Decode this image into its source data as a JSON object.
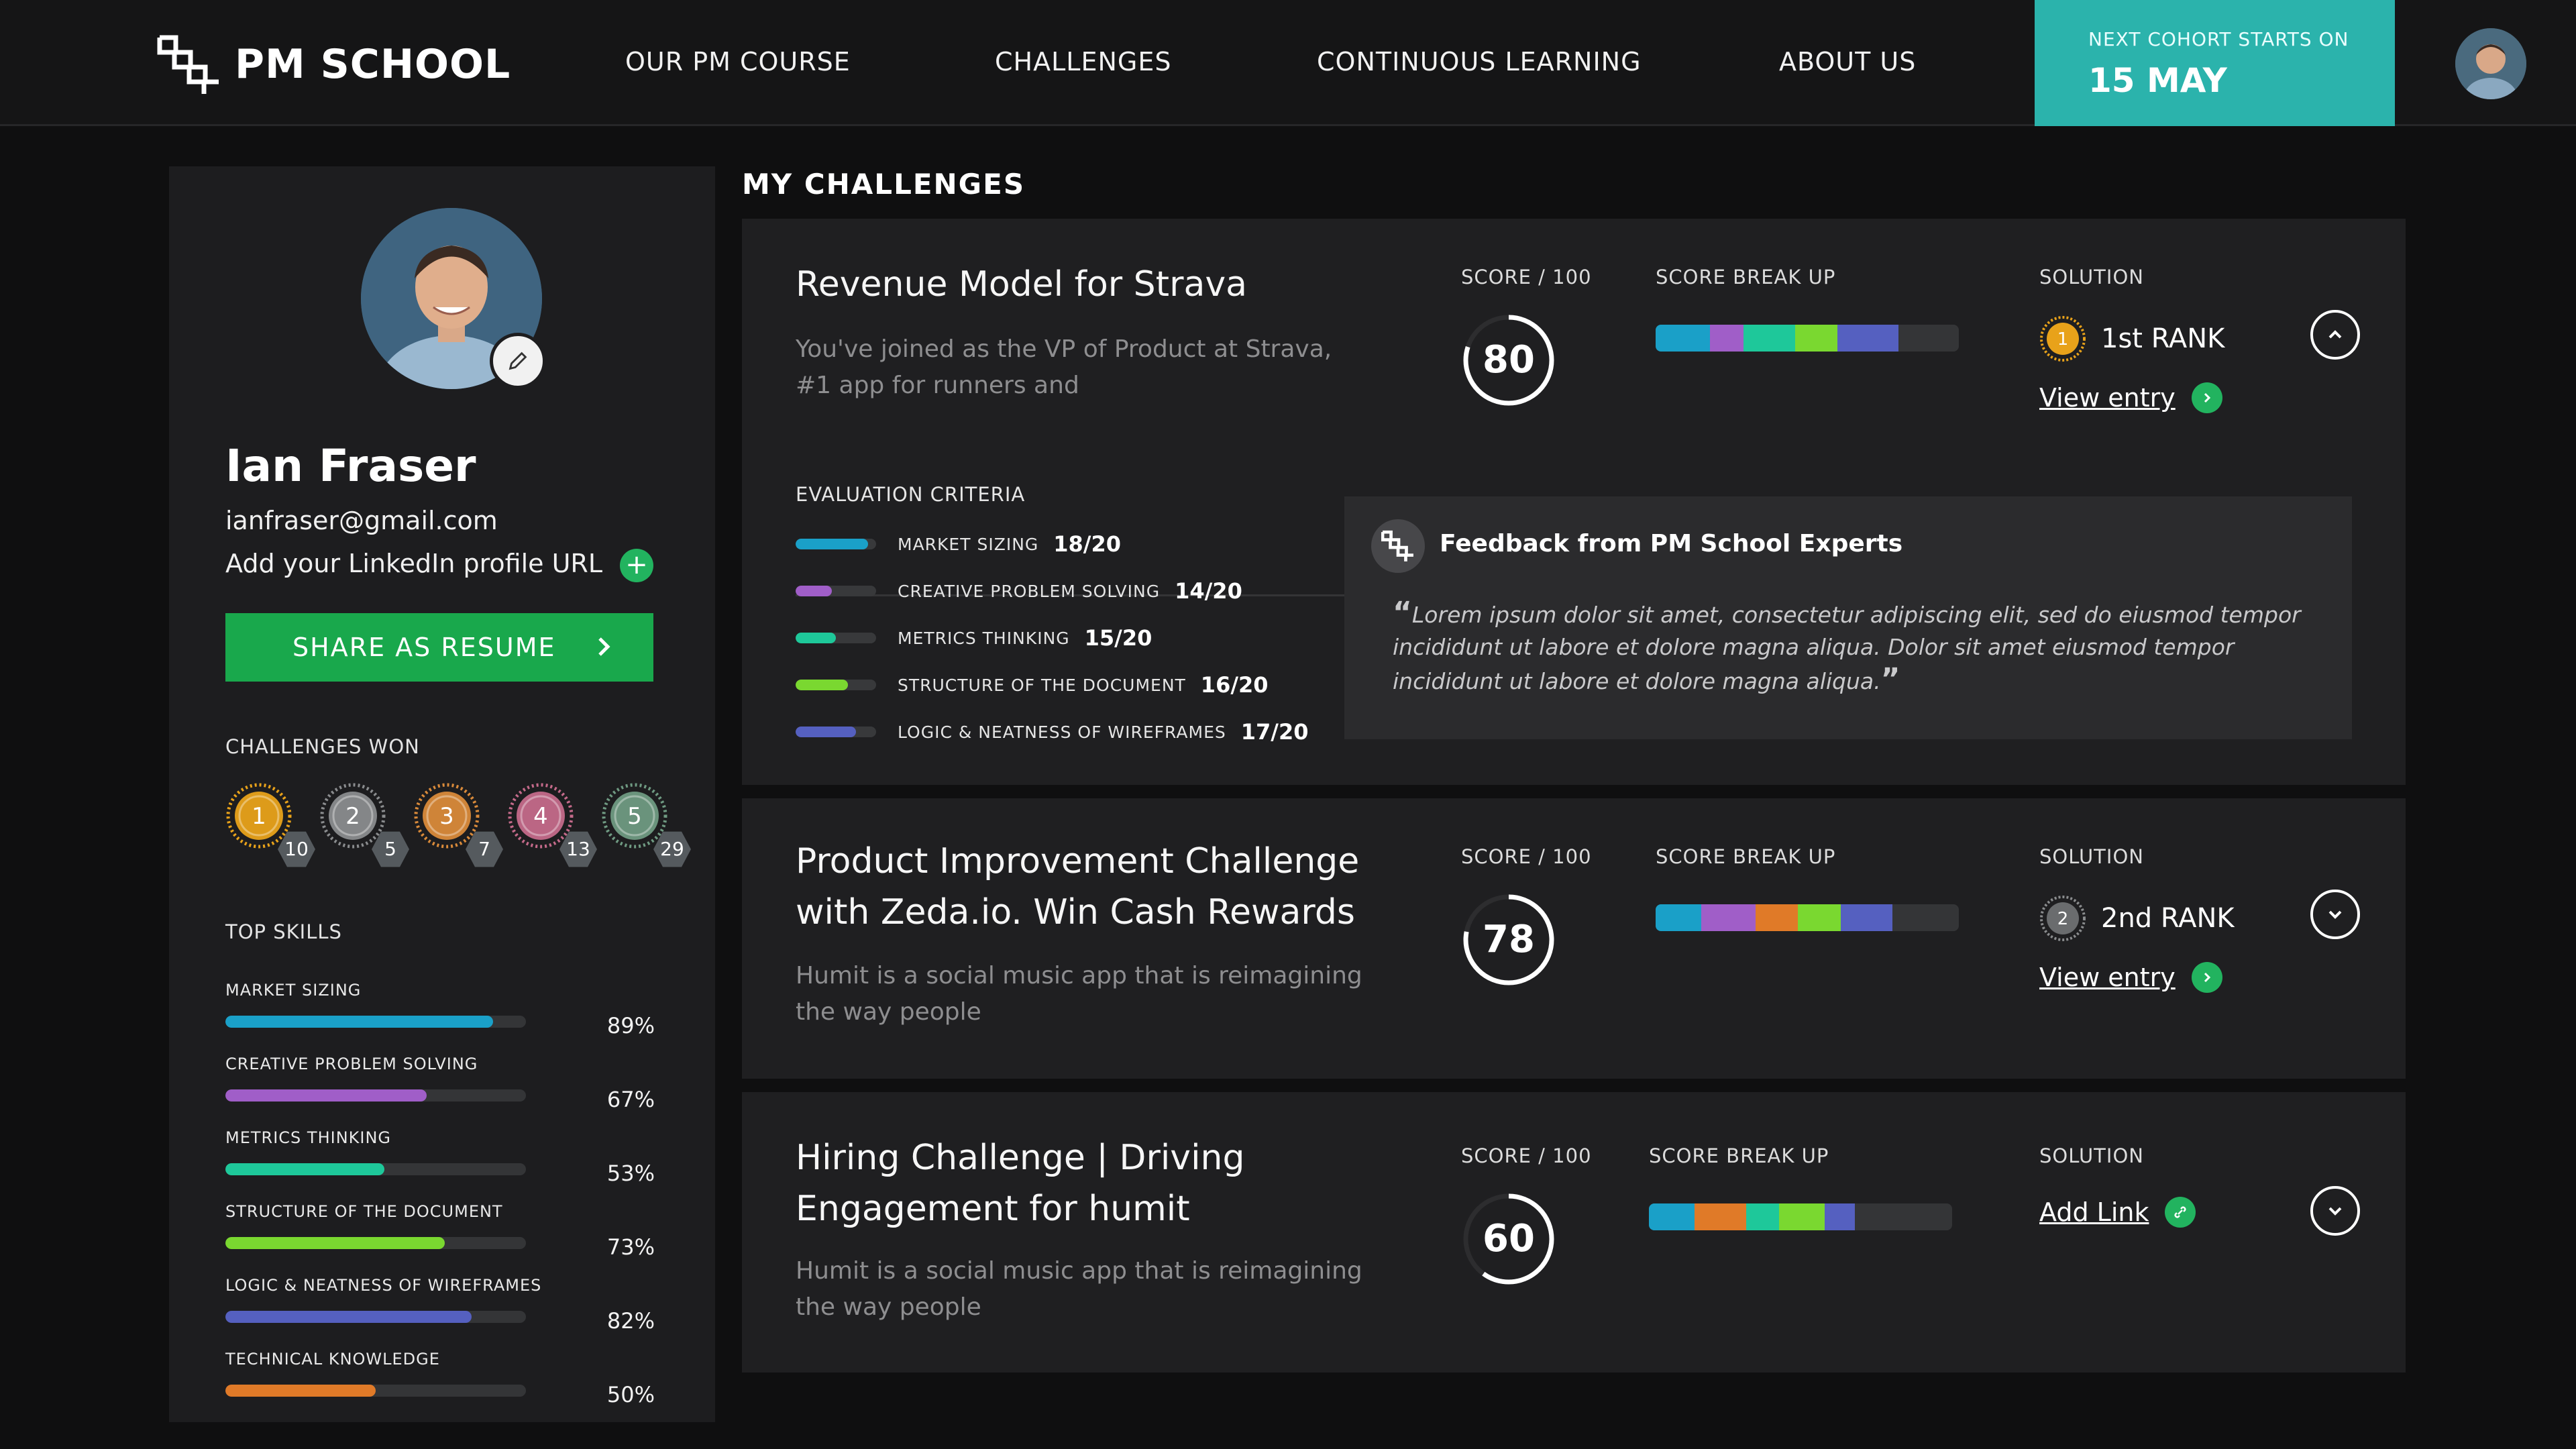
{
  "header": {
    "brand": "PM SCHOOL",
    "nav": [
      "OUR PM COURSE",
      "CHALLENGES",
      "CONTINUOUS LEARNING",
      "ABOUT US"
    ],
    "cohort_label": "NEXT COHORT STARTS ON",
    "cohort_date": "15 MAY"
  },
  "profile": {
    "name": "Ian Fraser",
    "email": "ianfraser@gmail.com",
    "linkedin_prompt": "Add your LinkedIn profile URL",
    "share_button": "SHARE AS RESUME",
    "challenges_won_label": "CHALLENGES WON",
    "medals": [
      {
        "rank": "1",
        "count": "10",
        "color": "#e8a21a"
      },
      {
        "rank": "2",
        "count": "5",
        "color": "#8a8c8e"
      },
      {
        "rank": "3",
        "count": "7",
        "color": "#d98a3a"
      },
      {
        "rank": "4",
        "count": "13",
        "color": "#c46a8a"
      },
      {
        "rank": "5",
        "count": "29",
        "color": "#6f9a82"
      }
    ],
    "top_skills_label": "TOP SKILLS",
    "skills": [
      {
        "name": "MARKET SIZING",
        "pct": "89%",
        "value": 0.89,
        "color": "#1aa0c8"
      },
      {
        "name": "CREATIVE PROBLEM SOLVING",
        "pct": "67%",
        "value": 0.67,
        "color": "#a05ec8"
      },
      {
        "name": "METRICS THINKING",
        "pct": "53%",
        "value": 0.53,
        "color": "#1ec89a"
      },
      {
        "name": "STRUCTURE OF THE DOCUMENT",
        "pct": "73%",
        "value": 0.73,
        "color": "#7ad830"
      },
      {
        "name": "LOGIC & NEATNESS OF WIREFRAMES",
        "pct": "82%",
        "value": 0.82,
        "color": "#5560c0"
      },
      {
        "name": "TECHNICAL KNOWLEDGE",
        "pct": "50%",
        "value": 0.5,
        "color": "#e07a28"
      }
    ]
  },
  "main": {
    "title": "MY CHALLENGES",
    "labels": {
      "score": "SCORE / 100",
      "breakup": "SCORE BREAK UP",
      "solution": "SOLUTION",
      "view_entry": "View entry",
      "eval": "EVALUATION CRITERIA",
      "add_link": "Add Link"
    },
    "cards": [
      {
        "title": "Revenue Model for Strava",
        "desc": "You've joined as the VP of Product at Strava, #1 app for runners and",
        "score": "80",
        "score_value": 80,
        "rank": "1st RANK",
        "rank_color": "#e8a21a",
        "rank_digit": "1",
        "breakup": [
          {
            "color": "#1aa0c8",
            "value": 18
          },
          {
            "color": "#a05ec8",
            "value": 11
          },
          {
            "color": "#1ec89a",
            "value": 17
          },
          {
            "color": "#7ad830",
            "value": 14
          },
          {
            "color": "#5560c0",
            "value": 20
          }
        ]
      },
      {
        "title": "Product Improvement Challenge with Zeda.io. Win Cash Rewards",
        "desc": "Humit is a social music app that is reimagining the way people",
        "score": "78",
        "score_value": 78,
        "rank": "2nd RANK",
        "rank_color": "#8a8c8e",
        "rank_digit": "2",
        "breakup": [
          {
            "color": "#1aa0c8",
            "value": 15
          },
          {
            "color": "#a05ec8",
            "value": 18
          },
          {
            "color": "#e07a28",
            "value": 14
          },
          {
            "color": "#7ad830",
            "value": 14
          },
          {
            "color": "#5560c0",
            "value": 17
          }
        ]
      },
      {
        "title": "Hiring Challenge | Driving Engagement for humit",
        "desc": "Humit is a social music app that is reimagining the way people",
        "score": "60",
        "score_value": 60,
        "breakup": [
          {
            "color": "#1aa0c8",
            "value": 15
          },
          {
            "color": "#e07a28",
            "value": 17
          },
          {
            "color": "#1ec89a",
            "value": 11
          },
          {
            "color": "#7ad830",
            "value": 15
          },
          {
            "color": "#5560c0",
            "value": 10
          }
        ]
      }
    ],
    "criteria": [
      {
        "name": "MARKET SIZING",
        "score": "18/20",
        "value": 0.9,
        "color": "#1aa0c8"
      },
      {
        "name": "CREATIVE PROBLEM SOLVING",
        "score": "14/20",
        "value": 0.45,
        "color": "#a05ec8"
      },
      {
        "name": "METRICS THINKING",
        "score": "15/20",
        "value": 0.5,
        "color": "#1ec89a"
      },
      {
        "name": "STRUCTURE OF THE DOCUMENT",
        "score": "16/20",
        "value": 0.65,
        "color": "#7ad830"
      },
      {
        "name": "LOGIC & NEATNESS OF WIREFRAMES",
        "score": "17/20",
        "value": 0.75,
        "color": "#5560c0"
      }
    ],
    "feedback": {
      "title": "Feedback from PM School Experts",
      "text": "Lorem ipsum dolor sit amet, consectetur adipiscing elit, sed do eiusmod tempor incididunt ut labore et dolore magna aliqua. Dolor sit amet eiusmod tempor incididunt ut labore et dolore magna aliqua."
    }
  }
}
